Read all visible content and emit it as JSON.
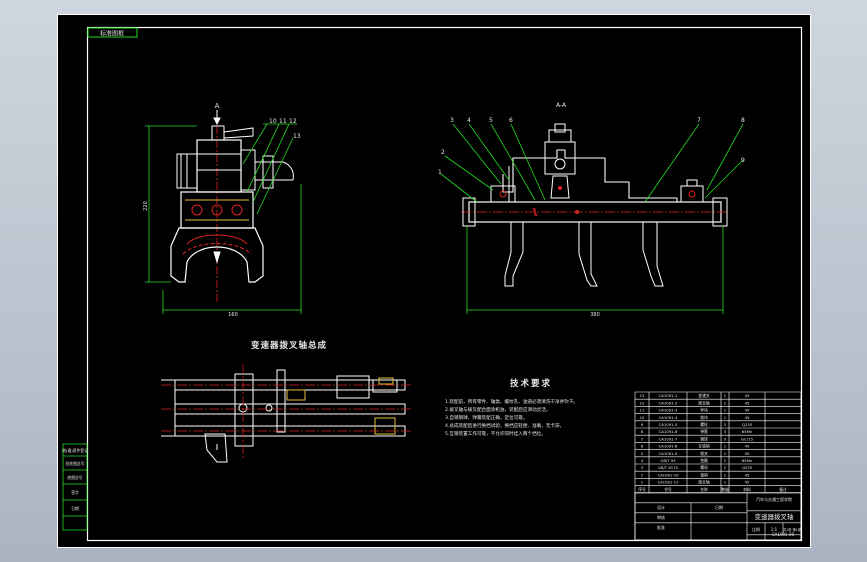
{
  "colors": {
    "background": "#000000",
    "frame": "#ffffff",
    "part_lines": "#ffffff",
    "leader_lines": "#22dd22",
    "dimension_lines": "#22dd22",
    "center_lines": "#dd2222",
    "hidden_parts": "#e6c040",
    "title_block_lines": "#ffffff",
    "side_table_lines": "#22dd22"
  },
  "drawing": {
    "corner_tag": "标准图框",
    "assembly_title": "变速器拨叉轴总成",
    "section_label": "A-A",
    "view_mark": "A",
    "dimensions": {
      "left_height": "220",
      "left_width": "160",
      "right_width": "380"
    },
    "balloons_left": [
      "10",
      "11",
      "12",
      "13"
    ],
    "balloons_right": [
      "1",
      "2",
      "3",
      "4",
      "5",
      "6",
      "7",
      "8",
      "9"
    ]
  },
  "tech_requirements": {
    "title": "技术要求",
    "items": [
      "1.装配前，所有零件、轴类、螺纹孔、油道必须清洗干净并吹干。",
      "2.拨叉轴与拨叉配合面涂机油，装配后应滑动灵活。",
      "3.自锁钢球、弹簧装配正确，定位可靠。",
      "4.总成装配后进行换挡试验，换挡应轻便、准确，无卡滞。",
      "5.互锁装置工作可靠，不允许同时挂入两个挡位。"
    ]
  },
  "parts_list": {
    "rows": [
      {
        "no": "13",
        "code": "CA1091-1",
        "name": "变速叉",
        "qty": "1",
        "mat": "45"
      },
      {
        "no": "12",
        "code": "CA1091-2",
        "name": "拨叉轴",
        "qty": "1",
        "mat": "45"
      },
      {
        "no": "11",
        "code": "CA1091-3",
        "name": "导块",
        "qty": "1",
        "mat": "45"
      },
      {
        "no": "10",
        "code": "CA1091-4",
        "name": "拨块",
        "qty": "1",
        "mat": "45"
      },
      {
        "no": "9",
        "code": "CA1091-5",
        "name": "螺栓",
        "qty": "2",
        "mat": "Q235"
      },
      {
        "no": "8",
        "code": "CA1091-6",
        "name": "弹簧",
        "qty": "3",
        "mat": "65Mn"
      },
      {
        "no": "7",
        "code": "CA1091-7",
        "name": "钢球",
        "qty": "3",
        "mat": "GCr15"
      },
      {
        "no": "6",
        "code": "CA1091-8",
        "name": "互锁销",
        "qty": "1",
        "mat": "45"
      },
      {
        "no": "5",
        "code": "CA1091-9",
        "name": "拨叉",
        "qty": "1",
        "mat": "45"
      },
      {
        "no": "4",
        "code": "GB/T 93",
        "name": "垫圈",
        "qty": "2",
        "mat": "65Mn"
      },
      {
        "no": "3",
        "code": "GB/T 6170",
        "name": "螺母",
        "qty": "2",
        "mat": "Q235"
      },
      {
        "no": "2",
        "code": "CA1091-10",
        "name": "锁销",
        "qty": "1",
        "mat": "45"
      },
      {
        "no": "1",
        "code": "CA1091-11",
        "name": "拨叉轴",
        "qty": "1",
        "mat": "45"
      }
    ],
    "header": {
      "no": "序号",
      "code": "代号",
      "name": "名称",
      "qty": "数量",
      "mat": "材料",
      "note": "备注"
    }
  },
  "title_block": {
    "company": "汽车与交通工程学院",
    "drawing_name": "变速器拨叉轴",
    "drawing_code": "CA1091-00",
    "scale_label": "比例",
    "scale": "1:1",
    "sheet": "共1张 第1张",
    "designer": "设计",
    "checker": "审核",
    "approver": "批准",
    "date": "日期"
  },
  "side_table": {
    "items": [
      "借(通)用件登记",
      "旧底图总号",
      "底图总号",
      "签字",
      "日期"
    ]
  }
}
